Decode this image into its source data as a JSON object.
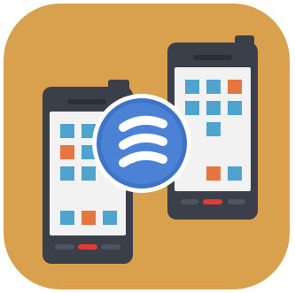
{
  "icon": {
    "name": "app-icon",
    "background_color": "#D9A04D",
    "phone_body_color": "#3A3F4A",
    "phone_screen_color": "#F2F2F2",
    "phone_speaker_color": "#2B2F37",
    "phone_button_color": "#4E5560",
    "phone_center_button_color": "#E53935",
    "tile_blue_color": "#4FA3CF",
    "tile_orange_color": "#E6753F",
    "badge_outer_color": "#3E73C7",
    "badge_inner_color": "#4B82D6",
    "badge_ring_color": "#FFFFFF",
    "badge_glyph": "stacked-waves-logo",
    "left_phone_icon": "smartphone-icon",
    "right_phone_icon": "smartphone-icon"
  }
}
